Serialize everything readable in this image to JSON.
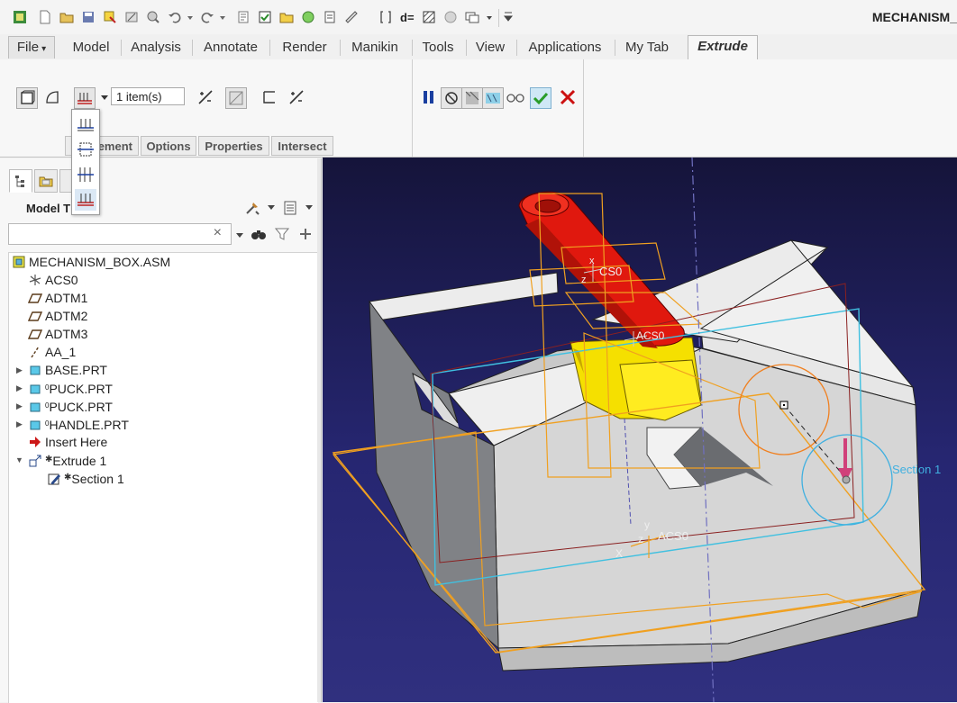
{
  "window": {
    "title": "MECHANISM_"
  },
  "quick_access": {
    "icons": [
      "app-icon",
      "new-icon",
      "open-icon",
      "save-icon",
      "regenerate-icon",
      "window-icon",
      "close-window-icon",
      "undo-icon",
      "undo-dropdown-icon",
      "redo-icon",
      "redo-dropdown-icon",
      "relations-icon",
      "checklist-icon",
      "folder-icon",
      "appearance-icon",
      "parameters-icon",
      "measure-icon",
      "brackets-icon",
      "dimension-icon",
      "hatch-icon",
      "status-icon",
      "windows-icon",
      "windows-dropdown-icon",
      "customize-icon"
    ]
  },
  "tabs": [
    {
      "label": "File",
      "dropdown": "▾"
    },
    {
      "label": "Model"
    },
    {
      "label": "Analysis"
    },
    {
      "label": "Annotate"
    },
    {
      "label": "Render"
    },
    {
      "label": "Manikin"
    },
    {
      "label": "Tools"
    },
    {
      "label": "View"
    },
    {
      "label": "Applications"
    },
    {
      "label": "My Tab"
    },
    {
      "label": "Extrude",
      "active": true
    }
  ],
  "ribbon": {
    "collector_value": "1 item(s)",
    "subtabs": [
      "ement",
      "Options",
      "Properties",
      "Intersect"
    ],
    "colors": {
      "pause": "#1a3fa0",
      "ok": "#2a9d2a",
      "cancel": "#cc1111"
    }
  },
  "dropdown": {
    "options": [
      "depth-blind-icon",
      "depth-symmetric-icon",
      "depth-to-next-icon",
      "depth-through-all-icon"
    ]
  },
  "left_panel": {
    "header_label": "Model T",
    "search_placeholder": "",
    "clear_glyph": "×",
    "tree": [
      {
        "label": "MECHANISM_BOX.ASM",
        "icon": "assembly-icon"
      },
      {
        "label": "ACS0",
        "icon": "csys-icon"
      },
      {
        "label": "ADTM1",
        "icon": "datum-plane-icon"
      },
      {
        "label": "ADTM2",
        "icon": "datum-plane-icon"
      },
      {
        "label": "ADTM3",
        "icon": "datum-plane-icon"
      },
      {
        "label": "AA_1",
        "icon": "datum-axis-icon"
      },
      {
        "label": "BASE.PRT",
        "icon": "part-icon",
        "expandable": true
      },
      {
        "label": "PUCK.PRT",
        "icon": "part-icon",
        "expandable": true
      },
      {
        "label": "PUCK.PRT",
        "icon": "part-icon",
        "expandable": true
      },
      {
        "label": "HANDLE.PRT",
        "icon": "part-icon",
        "expandable": true
      },
      {
        "label": "Insert Here",
        "icon": "insert-arrow-icon"
      },
      {
        "label": "Extrude 1",
        "icon": "extrude-icon",
        "expanded": true
      },
      {
        "label": "Section 1",
        "icon": "sketch-icon"
      }
    ]
  },
  "viewport": {
    "labels": {
      "section": "Section 1",
      "csys_a": "ACS0",
      "csys_b": "CS0",
      "csys_c": "ACS0",
      "axis_x": "x",
      "axis_y": "y",
      "axis_z": "z",
      "axis_xc": "X"
    },
    "colors": {
      "background_top": "#15143a",
      "background_bottom": "#30307f",
      "part": "#dcdcdc",
      "handle": "#e01a10",
      "puck": "#f0d000",
      "datum_plane": "#f0a020",
      "section_plane": "#40c0e0"
    }
  }
}
